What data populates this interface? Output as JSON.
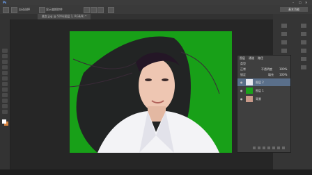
{
  "menubar": {
    "logo": "Ps",
    "window_controls": [
      "–",
      "□",
      "✕"
    ]
  },
  "optionsbar": {
    "checkbox_label": "自动选择",
    "show_transform_label": "显示变换控件",
    "workspace": "基本功能"
  },
  "document_tab": {
    "title": "美女.jpg @ 50%(图层 1, RGB/8) *"
  },
  "colors": {
    "foreground": "#ffffff",
    "background": "#d8833f",
    "green_screen": "#18a018"
  },
  "layers_panel": {
    "tabs": [
      "图层",
      "通道",
      "路径"
    ],
    "kind_label": "类型",
    "blend_mode": "正常",
    "opacity_label": "不透明度",
    "opacity_value": "100%",
    "lock_label": "锁定",
    "fill_label": "填充",
    "fill_value": "100%",
    "layers": [
      {
        "name": "图层 2",
        "selected": true,
        "thumb_color": "#e8e8ef"
      },
      {
        "name": "图层 1",
        "selected": false,
        "thumb_color": "#1aa31a"
      },
      {
        "name": "背景",
        "selected": false,
        "thumb_color": "#c99a8a"
      }
    ]
  }
}
